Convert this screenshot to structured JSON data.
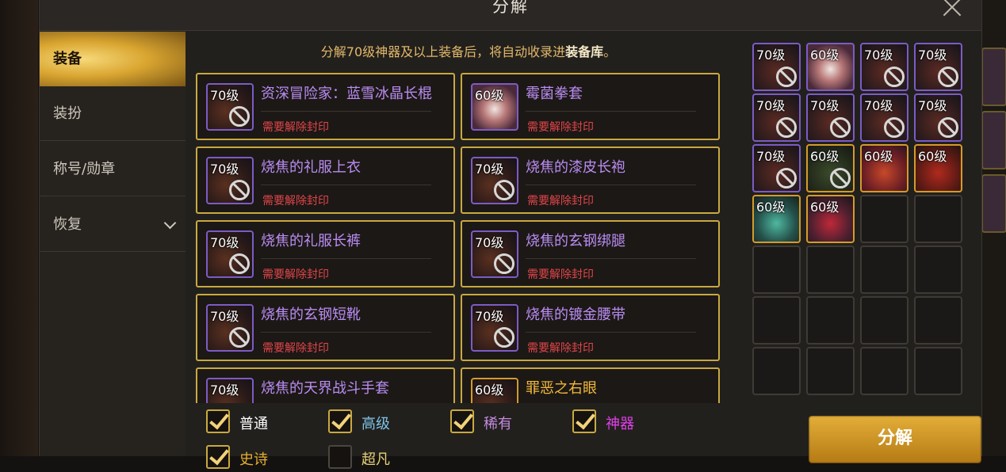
{
  "title": "分解",
  "sidebar": {
    "items": [
      {
        "label": "装备",
        "active": true
      },
      {
        "label": "装扮",
        "active": false
      },
      {
        "label": "称号/勋章",
        "active": false
      },
      {
        "label": "恢复",
        "active": false,
        "expandable": true
      }
    ]
  },
  "notice": {
    "prefix": "分解70级神器及以上装备后，将自动收录进",
    "highlight": "装备库",
    "suffix": "。"
  },
  "items": [
    {
      "level": "70级",
      "name": "资深冒险家：蓝雪冰晶长棍",
      "status": "需要解除封印",
      "rarity": "epic",
      "locked": true
    },
    {
      "level": "60级",
      "name": "霉菌拳套",
      "status": "需要解除封印",
      "rarity": "epic",
      "locked": false
    },
    {
      "level": "70级",
      "name": "烧焦的礼服上衣",
      "status": "需要解除封印",
      "rarity": "epic",
      "locked": true
    },
    {
      "level": "70级",
      "name": "烧焦的漆皮长袍",
      "status": "需要解除封印",
      "rarity": "epic",
      "locked": true
    },
    {
      "level": "70级",
      "name": "烧焦的礼服长裤",
      "status": "需要解除封印",
      "rarity": "epic",
      "locked": true
    },
    {
      "level": "70级",
      "name": "烧焦的玄钢绑腿",
      "status": "需要解除封印",
      "rarity": "epic",
      "locked": true
    },
    {
      "level": "70级",
      "name": "烧焦的玄钢短靴",
      "status": "需要解除封印",
      "rarity": "epic",
      "locked": true
    },
    {
      "level": "70级",
      "name": "烧焦的镀金腰带",
      "status": "需要解除封印",
      "rarity": "epic",
      "locked": true
    },
    {
      "level": "70级",
      "name": "烧焦的天界战斗手套",
      "status": "",
      "rarity": "epic",
      "locked": false
    },
    {
      "level": "60级",
      "name": "罪恶之右眼",
      "status": "",
      "rarity": "legendary",
      "locked": false
    }
  ],
  "inventory": [
    {
      "level": "70级",
      "rarity": "epic",
      "locked": true
    },
    {
      "level": "60级",
      "rarity": "epic",
      "locked": false
    },
    {
      "level": "70级",
      "rarity": "epic",
      "locked": true
    },
    {
      "level": "70级",
      "rarity": "epic",
      "locked": true
    },
    {
      "level": "70级",
      "rarity": "epic",
      "locked": true
    },
    {
      "level": "70级",
      "rarity": "epic",
      "locked": true
    },
    {
      "level": "70级",
      "rarity": "epic",
      "locked": true
    },
    {
      "level": "70级",
      "rarity": "epic",
      "locked": true
    },
    {
      "level": "70级",
      "rarity": "epic",
      "locked": true
    },
    {
      "level": "60级",
      "rarity": "legendary",
      "locked": true
    },
    {
      "level": "60级",
      "rarity": "legendary",
      "locked": false
    },
    {
      "level": "60级",
      "rarity": "legendary",
      "locked": false
    },
    {
      "level": "60级",
      "rarity": "legendary",
      "locked": false
    },
    {
      "level": "60级",
      "rarity": "legendary",
      "locked": false
    }
  ],
  "filters": [
    {
      "label": "普通",
      "checked": true,
      "color": "#ffffff"
    },
    {
      "label": "高级",
      "checked": true,
      "color": "#7fc3e8"
    },
    {
      "label": "稀有",
      "checked": true,
      "color": "#c48be0"
    },
    {
      "label": "神器",
      "checked": true,
      "color": "#e040e8"
    },
    {
      "label": "史诗",
      "checked": true,
      "color": "#e6b030"
    },
    {
      "label": "超凡",
      "checked": false,
      "color": "#e8d37a"
    }
  ],
  "decompose_label": "分解",
  "colors": {
    "accent_gold": "#c9a940",
    "epic": "#b98cf2",
    "legendary": "#f2b93c",
    "warning": "#e0454a"
  }
}
